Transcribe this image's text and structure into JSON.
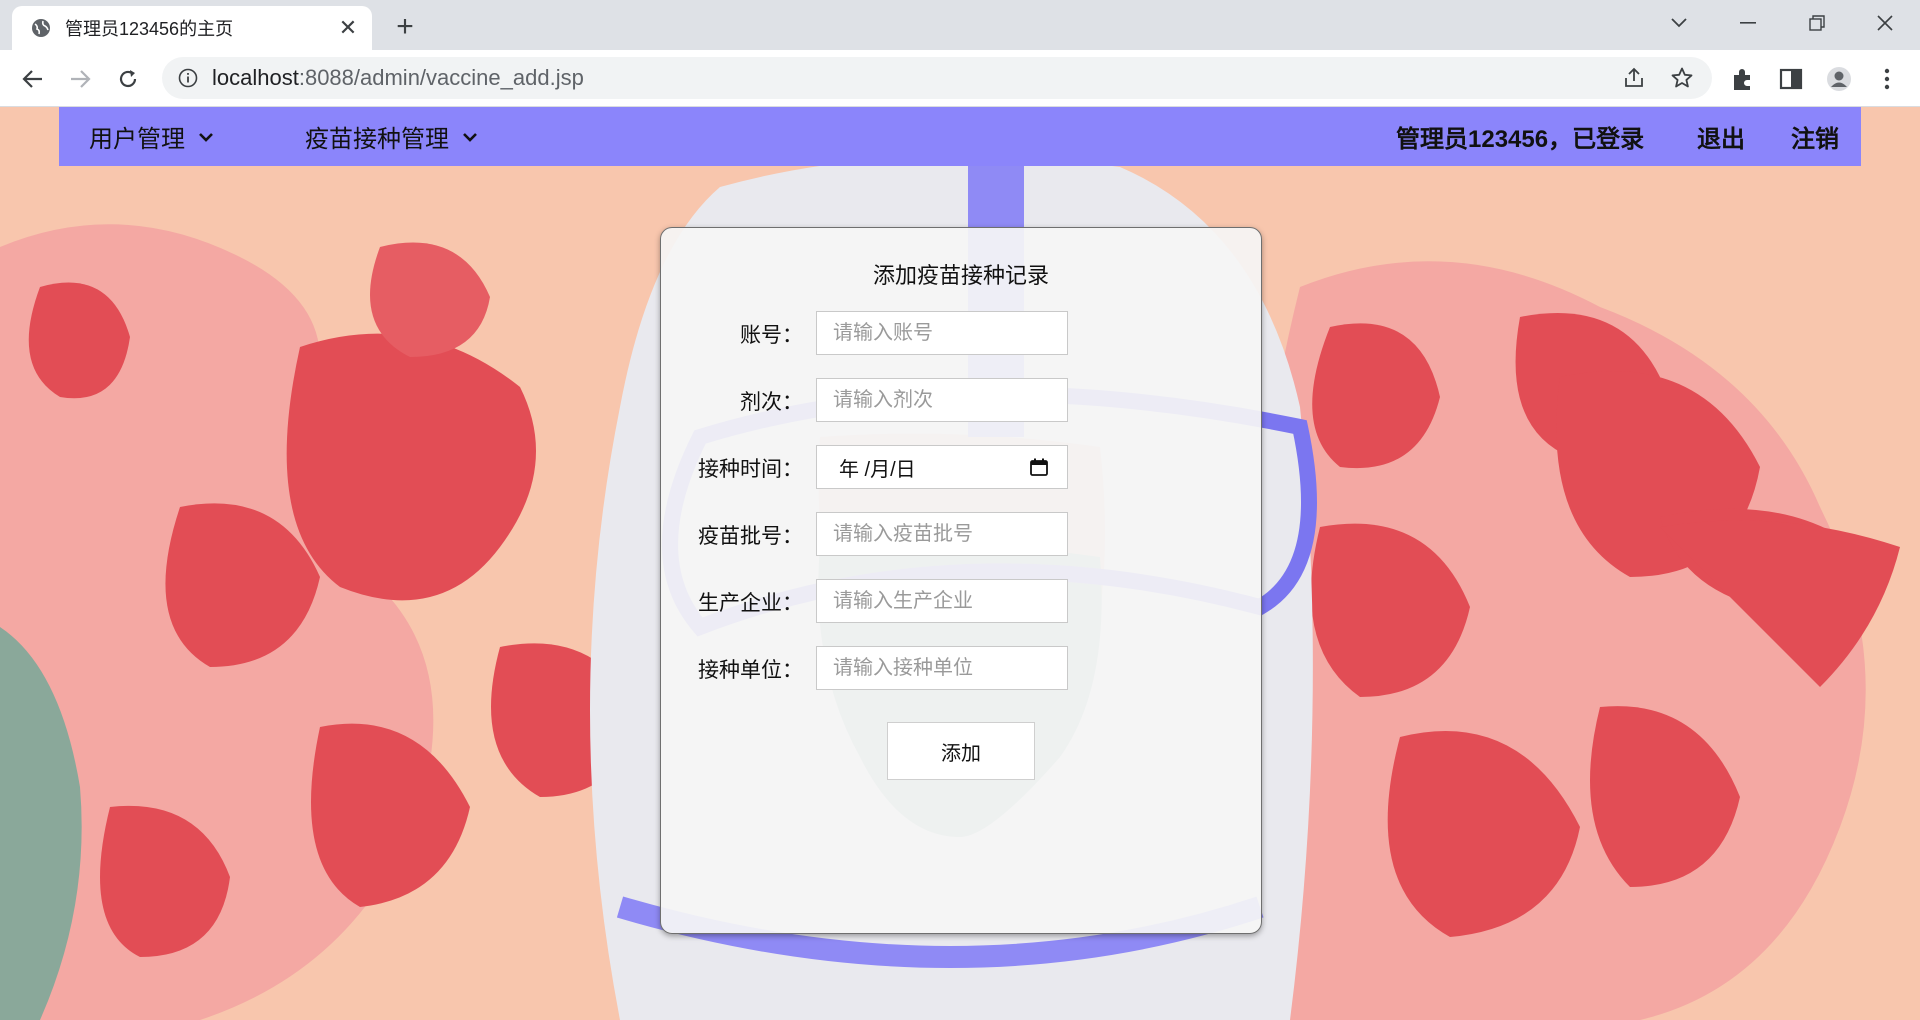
{
  "browser": {
    "tab_title": "管理员123456的主页",
    "url_host": "localhost",
    "url_rest": ":8088/admin/vaccine_add.jsp"
  },
  "nav": {
    "menu": [
      {
        "label": "用户管理"
      },
      {
        "label": "疫苗接种管理"
      }
    ],
    "status": "管理员123456，已登录",
    "logout": "退出",
    "cancel_account": "注销"
  },
  "form": {
    "title": "添加疫苗接种记录",
    "fields": [
      {
        "label": "账号：",
        "placeholder": "请输入账号"
      },
      {
        "label": "剂次：",
        "placeholder": "请输入剂次"
      },
      {
        "label": "接种时间：",
        "value": "年 /月/日"
      },
      {
        "label": "疫苗批号：",
        "placeholder": "请输入疫苗批号"
      },
      {
        "label": "生产企业：",
        "placeholder": "请输入生产企业"
      },
      {
        "label": "接种单位：",
        "placeholder": "请输入接种单位"
      }
    ],
    "submit": "添加"
  },
  "colors": {
    "nav_bg": "#8b85fb",
    "panel_bg": "#f5f5f5"
  }
}
